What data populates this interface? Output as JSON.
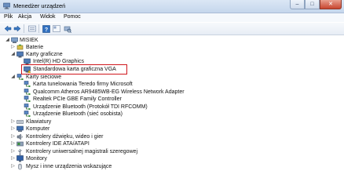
{
  "window": {
    "title": "Menedżer urządzeń",
    "minimize": "–",
    "maximize": "□",
    "close": "✕"
  },
  "menu": {
    "items": [
      "Plik",
      "Akcja",
      "Widok",
      "Pomoc"
    ]
  },
  "toolbar": {
    "icons": [
      "back-arrow-icon",
      "forward-arrow-icon",
      "properties-icon",
      "help-icon",
      "scan-hardware-icon"
    ]
  },
  "tree": {
    "root": "MISIEK",
    "nodes": [
      {
        "label": "Baterie",
        "expanded": false
      },
      {
        "label": "Karty graficzne",
        "expanded": true,
        "children": [
          "Intel(R) HD Graphics",
          "Standardowa karta graficzna VGA"
        ]
      },
      {
        "label": "Karty sieciowe",
        "expanded": true,
        "children": [
          "Karta tunelowania Teredo firmy Microsoft",
          "Qualcomm Atheros AR9485WB-EG Wireless Network Adapter",
          "Realtek PCIe GBE Family Controller",
          "Urządzenie Bluetooth (Protokół TDI RFCOMM)",
          "Urządzenie Bluetooth (sieć osobista)"
        ]
      },
      {
        "label": "Klawiatury",
        "expanded": false
      },
      {
        "label": "Komputer",
        "expanded": false
      },
      {
        "label": "Kontrolery dźwięku, wideo i gier",
        "expanded": false
      },
      {
        "label": "Kontrolery IDE ATA/ATAPI",
        "expanded": false
      },
      {
        "label": "Kontrolery uniwersalnej magistrali szeregowej",
        "expanded": false
      },
      {
        "label": "Monitory",
        "expanded": false
      },
      {
        "label": "Mysz i inne urządzenia wskazujące",
        "expanded": false
      }
    ]
  },
  "colors": {
    "highlight_border": "#d0171d",
    "title_bar": "#c5d6ec"
  }
}
